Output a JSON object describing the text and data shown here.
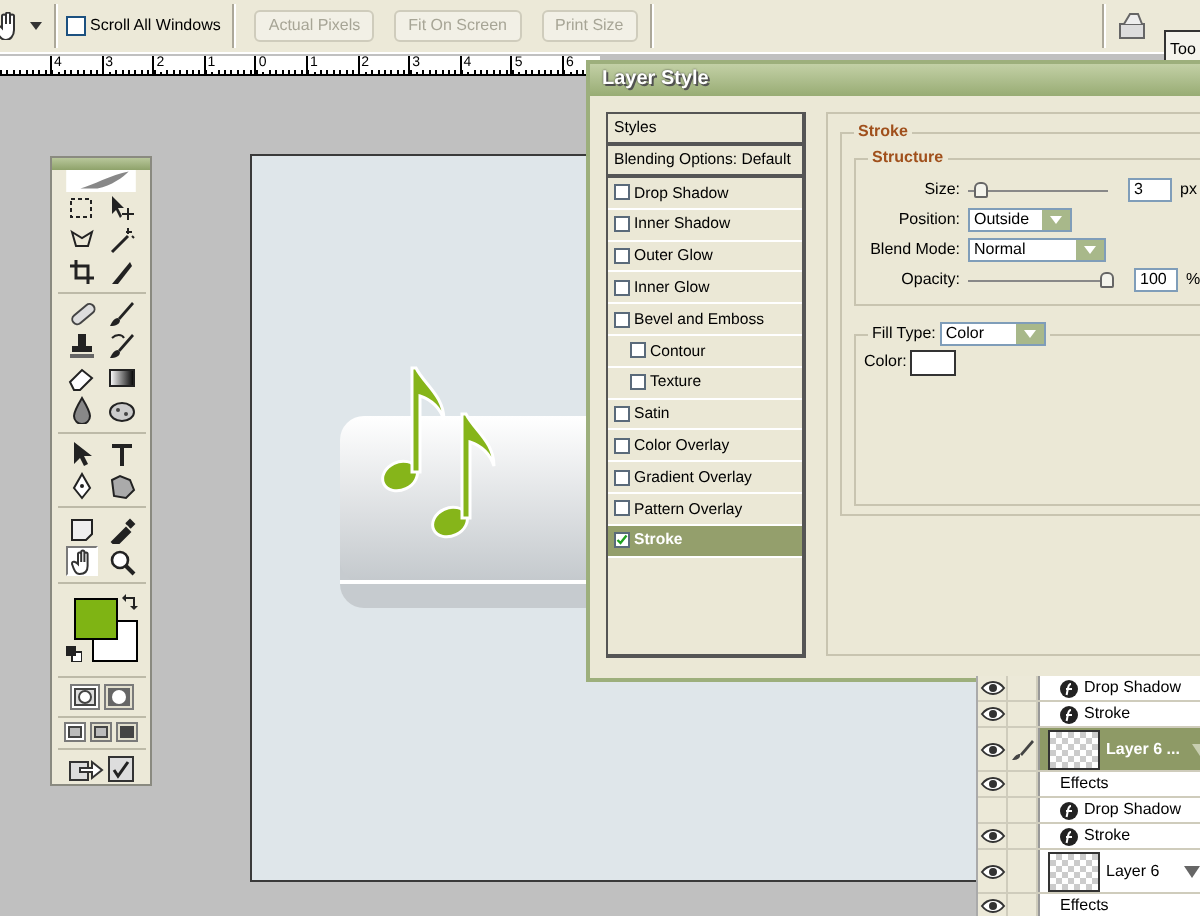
{
  "options_bar": {
    "scroll_all_windows": {
      "label": "Scroll All Windows",
      "checked": false
    },
    "buttons": [
      {
        "label": "Actual Pixels",
        "disabled": true
      },
      {
        "label": "Fit On Screen",
        "disabled": true
      },
      {
        "label": "Print Size",
        "disabled": true
      }
    ],
    "palette_tab": "Too"
  },
  "ruler": {
    "labels": [
      "4",
      "3",
      "2",
      "1",
      "0",
      "1",
      "2",
      "3",
      "4",
      "5",
      "6"
    ]
  },
  "toolbox": {
    "tools": [
      {
        "kind": "marquee",
        "selected": false
      },
      {
        "kind": "move",
        "selected": false
      },
      {
        "kind": "lasso",
        "selected": false
      },
      {
        "kind": "wand",
        "selected": false
      },
      {
        "kind": "crop",
        "selected": false
      },
      {
        "kind": "slice",
        "selected": false
      },
      {
        "kind": "healing",
        "selected": false
      },
      {
        "kind": "brush",
        "selected": false
      },
      {
        "kind": "stamp",
        "selected": false
      },
      {
        "kind": "history",
        "selected": false
      },
      {
        "kind": "eraser",
        "selected": false
      },
      {
        "kind": "gradient",
        "selected": false
      },
      {
        "kind": "blur",
        "selected": false
      },
      {
        "kind": "dodge",
        "selected": false
      },
      {
        "kind": "path",
        "selected": false
      },
      {
        "kind": "type",
        "selected": false
      },
      {
        "kind": "pen",
        "selected": false
      },
      {
        "kind": "shape",
        "selected": false
      },
      {
        "kind": "notes",
        "selected": false
      },
      {
        "kind": "eyedropper",
        "selected": false
      },
      {
        "kind": "hand",
        "selected": true
      },
      {
        "kind": "zoom",
        "selected": false
      }
    ],
    "mask_modes": [
      {
        "selected": true
      },
      {
        "selected": false
      }
    ],
    "screen_modes": [
      {
        "selected": true
      },
      {
        "selected": false
      },
      {
        "selected": false
      }
    ]
  },
  "dialog": {
    "title": "Layer Style",
    "styles": [
      {
        "kind": "header",
        "label": "Styles",
        "selected": false
      },
      {
        "kind": "header",
        "label": "Blending Options: Default",
        "selected": false
      },
      {
        "kind": "option",
        "label": "Drop Shadow",
        "checked": false,
        "selected": false
      },
      {
        "kind": "option",
        "label": "Inner Shadow",
        "checked": false,
        "selected": false
      },
      {
        "kind": "option",
        "label": "Outer Glow",
        "checked": false,
        "selected": false
      },
      {
        "kind": "option",
        "label": "Inner Glow",
        "checked": false,
        "selected": false
      },
      {
        "kind": "option",
        "label": "Bevel and Emboss",
        "checked": false,
        "selected": false
      },
      {
        "kind": "suboption",
        "label": "Contour",
        "checked": false,
        "selected": false
      },
      {
        "kind": "suboption",
        "label": "Texture",
        "checked": false,
        "selected": false
      },
      {
        "kind": "option",
        "label": "Satin",
        "checked": false,
        "selected": false
      },
      {
        "kind": "option",
        "label": "Color Overlay",
        "checked": false,
        "selected": false
      },
      {
        "kind": "option",
        "label": "Gradient Overlay",
        "checked": false,
        "selected": false
      },
      {
        "kind": "option",
        "label": "Pattern Overlay",
        "checked": false,
        "selected": false
      },
      {
        "kind": "option",
        "label": "Stroke",
        "checked": true,
        "selected": true
      }
    ],
    "stroke": {
      "legend": "Stroke",
      "structure": {
        "legend": "Structure",
        "size": {
          "label": "Size:",
          "level": 0.05,
          "value": "3",
          "unit": "px"
        },
        "position": {
          "label": "Position:",
          "value": "Outside"
        },
        "blend_mode": {
          "label": "Blend Mode:",
          "value": "Normal"
        },
        "opacity": {
          "label": "Opacity:",
          "level": 1,
          "value": "100",
          "unit": "%"
        }
      },
      "fill_type": {
        "label": "Fill Type:",
        "value": "Color"
      },
      "color": {
        "label": "Color:"
      }
    }
  },
  "layers": [
    {
      "kind": "effect",
      "label": "Drop Shadow",
      "visible": true,
      "linked": false,
      "selected": false
    },
    {
      "kind": "effect",
      "label": "Stroke",
      "visible": true,
      "linked": false,
      "selected": false
    },
    {
      "kind": "layer",
      "label": "Layer 6 ...",
      "visible": true,
      "linked": true,
      "selected": true
    },
    {
      "kind": "effects_header",
      "label": "Effects",
      "visible": true,
      "linked": false,
      "selected": false
    },
    {
      "kind": "effect",
      "label": "Drop Shadow",
      "visible": false,
      "linked": false,
      "selected": false
    },
    {
      "kind": "effect",
      "label": "Stroke",
      "visible": true,
      "linked": false,
      "selected": false
    },
    {
      "kind": "layer",
      "label": "Layer 6",
      "visible": true,
      "linked": false,
      "selected": false
    },
    {
      "kind": "effects_header",
      "label": "Effects",
      "visible": true,
      "linked": false,
      "selected": false
    }
  ]
}
